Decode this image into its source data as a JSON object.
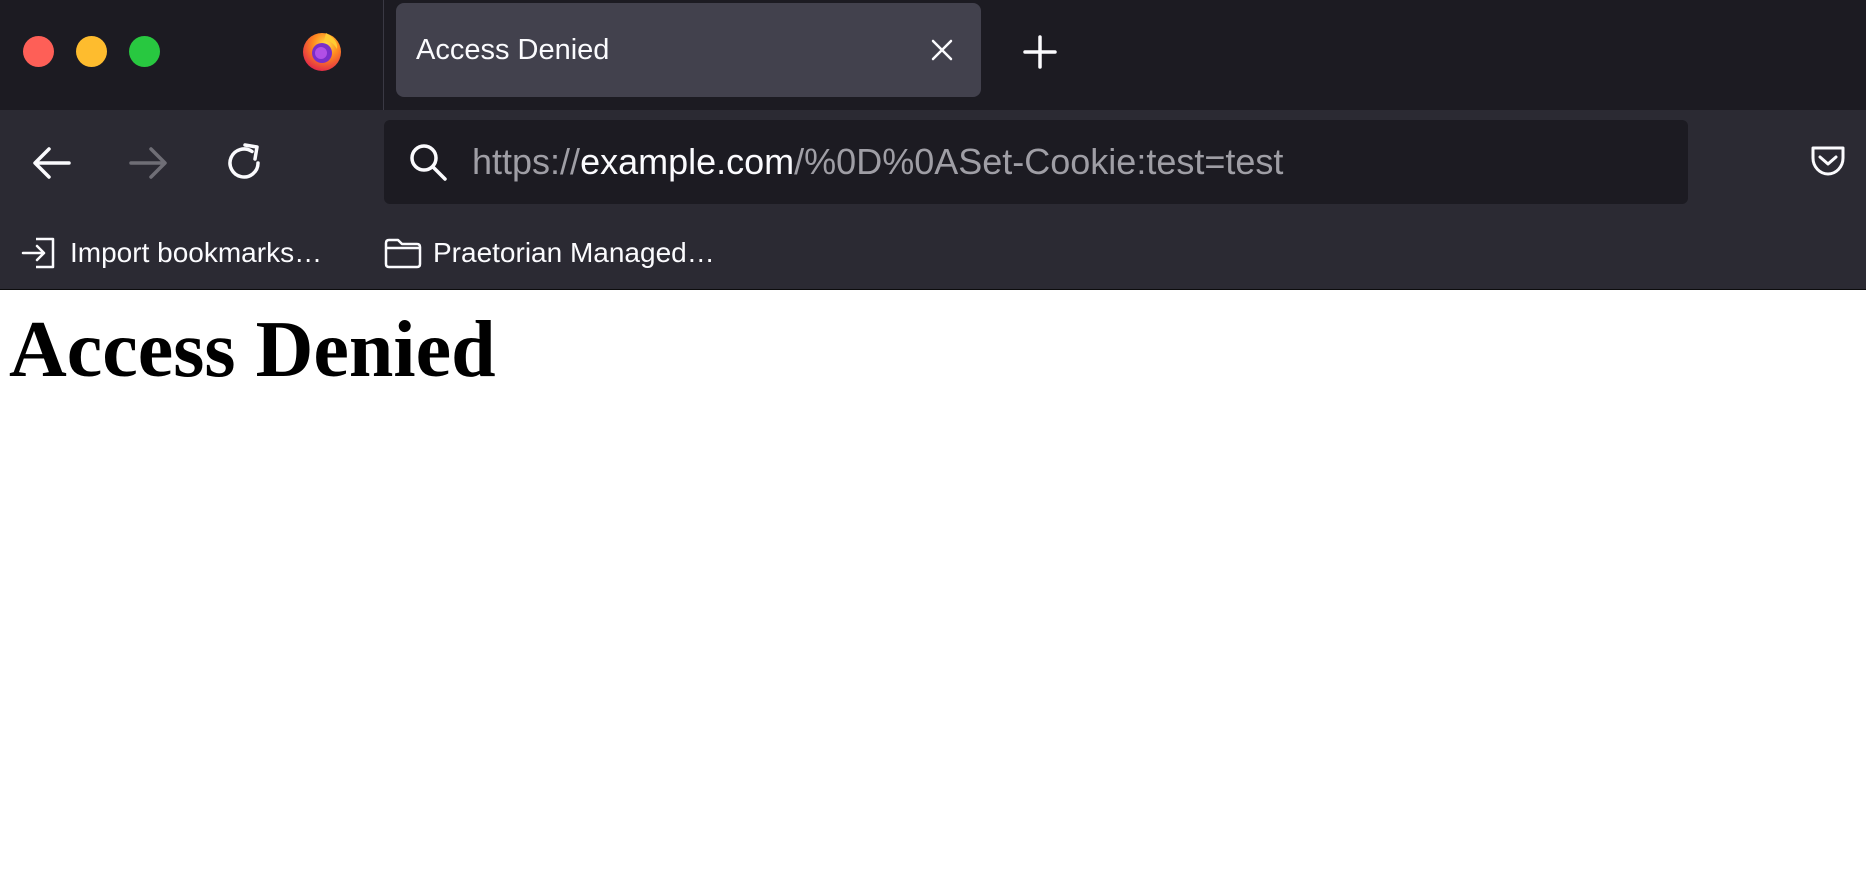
{
  "tab": {
    "title": "Access Denied"
  },
  "url": {
    "scheme": "https://",
    "host": "example.com",
    "path": "/%0D%0ASet-Cookie:test=test"
  },
  "bookmarks": [
    {
      "label": "Import bookmarks…",
      "icon": "import-icon"
    },
    {
      "label": "Praetorian Managed…",
      "icon": "folder-icon"
    }
  ],
  "page": {
    "heading": "Access Denied"
  },
  "colors": {
    "tabstrip_bg": "#1c1b22",
    "toolbar_bg": "#2b2a33",
    "active_tab_bg": "#42414d",
    "urlbar_bg": "#1c1b22",
    "url_dim_text": "#9f9ea5",
    "url_host_text": "#fbfbfe",
    "traffic_close": "#fe5f57",
    "traffic_minimize": "#febc2e",
    "traffic_maximize": "#28c840"
  }
}
